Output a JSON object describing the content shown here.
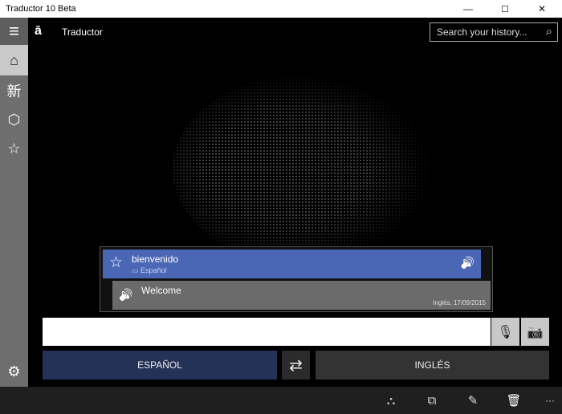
{
  "window": {
    "title": "Traductor 10 Beta",
    "minimize": "—",
    "maximize": "☐",
    "close": "✕"
  },
  "app": {
    "title": "Traductor",
    "logo": "translator-logo"
  },
  "sidebar": {
    "items": [
      {
        "name": "menu",
        "icon": "≡"
      },
      {
        "name": "home",
        "icon": "⌂",
        "selected": true
      },
      {
        "name": "phrasebook",
        "icon": "新"
      },
      {
        "name": "cube",
        "icon": "⬡"
      },
      {
        "name": "favorites",
        "icon": "☆"
      }
    ],
    "settings_icon": "⚙"
  },
  "search": {
    "placeholder": "Search your history...",
    "icon": "⌕"
  },
  "history": {
    "source": {
      "text": "bienvenido",
      "language": "Español",
      "favorite_icon": "☆",
      "speaker_icon": "🔊"
    },
    "target": {
      "text": "Welcome",
      "meta": "Inglés, 17/09/2015",
      "speaker_icon": "🔊"
    }
  },
  "input": {
    "value": "",
    "mic_icon": "🎙",
    "camera_icon": "📷"
  },
  "languages": {
    "from": "ESPAÑOL",
    "to": "INGLÉS",
    "swap_icon": "⇄"
  },
  "toolbar": {
    "share": "⛬",
    "copy": "⧉",
    "edit": "✎",
    "delete": "🗑",
    "more": "···"
  },
  "colors": {
    "accent": "#4a67b6",
    "from_lang": "#243257",
    "sidebar": "#6e6e6e"
  }
}
